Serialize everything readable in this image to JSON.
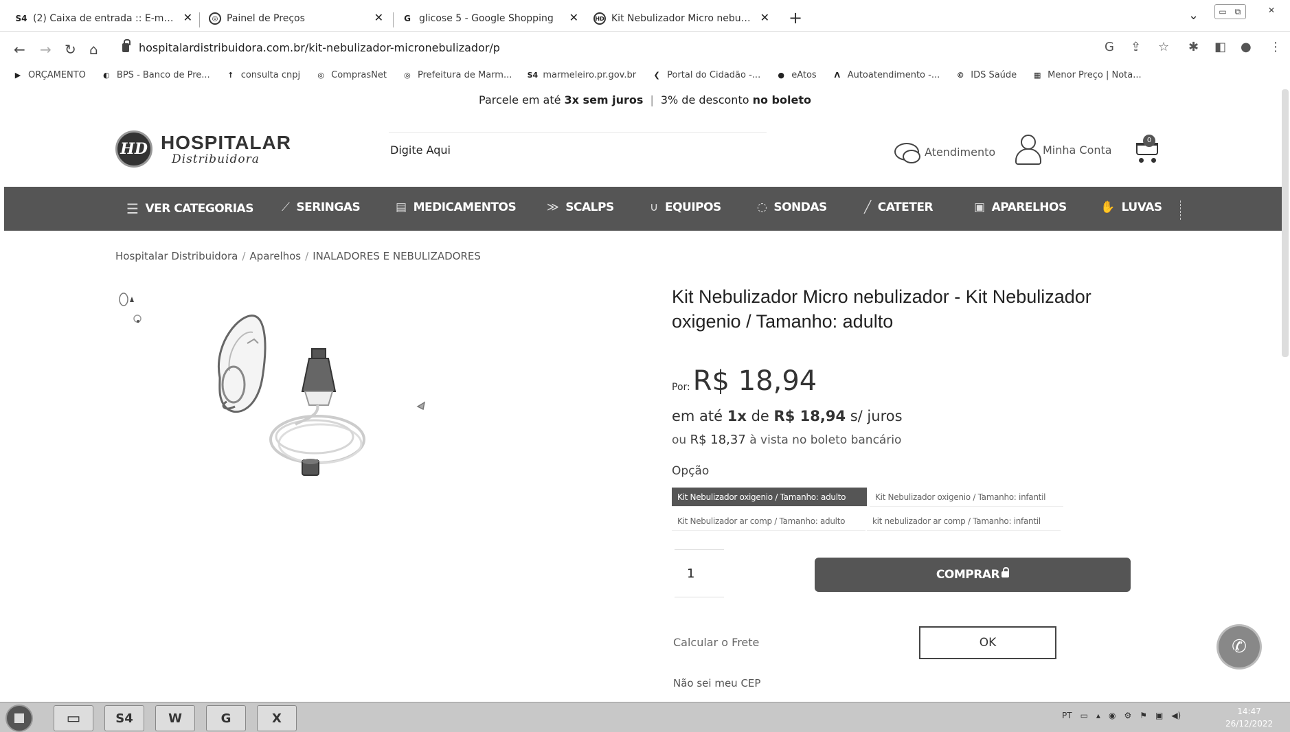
{
  "browser": {
    "tabs": [
      {
        "favicon": "S4",
        "label": "(2) Caixa de entrada :: E-mail - ..."
      },
      {
        "favicon": "globe",
        "label": "Painel de Preços"
      },
      {
        "favicon": "G",
        "label": "glicose 5 - Google Shopping"
      },
      {
        "favicon": "HD",
        "label": "Kit Nebulizador Micro nebulizad..."
      }
    ],
    "url": "hospitalardistribuidora.com.br/kit-nebulizador-micronebulizador/p",
    "bookmarks": [
      "ORÇAMENTO",
      "BPS - Banco de Pre...",
      "consulta cnpj",
      "ComprasNet",
      "Prefeitura de Marm...",
      "marmeleiro.pr.gov.br",
      "Portal do Cidadão -...",
      "eAtos",
      "Autoatendimento -...",
      "IDS Saúde",
      "Menor Preço | Nota..."
    ]
  },
  "promo": {
    "part1": "Parcele em até ",
    "part1_bold": "3x sem juros",
    "sep": "|",
    "part2": "3% de desconto ",
    "part2_bold": "no boleto"
  },
  "header": {
    "logo_mark": "HD",
    "logo_title": "HOSPITALAR",
    "logo_subtitle": "Distribuidora",
    "search_placeholder": "Digite Aqui",
    "atendimento": "Atendimento",
    "minha_conta": "Minha Conta",
    "cart_count": "0"
  },
  "categories": [
    {
      "icon": "☰",
      "label": "VER CATEGORIAS"
    },
    {
      "icon": "⟋",
      "label": "SERINGAS"
    },
    {
      "icon": "▤",
      "label": "MEDICAMENTOS"
    },
    {
      "icon": "≫",
      "label": "SCALPS"
    },
    {
      "icon": "∪",
      "label": "EQUIPOS"
    },
    {
      "icon": "◌",
      "label": "SONDAS"
    },
    {
      "icon": "╱",
      "label": "CATETER"
    },
    {
      "icon": "▣",
      "label": "APARELHOS"
    },
    {
      "icon": "✋",
      "label": "LUVAS"
    }
  ],
  "breadcrumb": [
    "Hospitalar Distribuidora",
    "Aparelhos",
    "INALADORES E NEBULIZADORES"
  ],
  "product": {
    "title": "Kit Nebulizador Micro nebulizador - Kit Nebulizador oxigenio / Tamanho: adulto",
    "price_prefix": "Por:",
    "price": "R$ 18,94",
    "installment_pre": "em até ",
    "installment_count": "1x",
    "installment_mid": " de ",
    "installment_value": "R$ 18,94",
    "installment_post": " s/ juros",
    "cash_pre": "ou ",
    "cash_value": "R$ 18,37",
    "cash_post": " à vista no boleto bancário",
    "option_label": "Opção",
    "options": [
      "Kit Nebulizador oxigenio / Tamanho: adulto",
      "Kit Nebulizador oxigenio / Tamanho: infantil",
      "Kit Nebulizador ar comp / Tamanho: adulto",
      "kit nebulizador ar comp / Tamanho: infantil"
    ],
    "quantity": "1",
    "buy_label": "COMPRAR",
    "shipping_label": "Calcular o Frete",
    "ok_label": "OK",
    "cep_link": "Não sei meu CEP"
  },
  "taskbar": {
    "apps": [
      "S4",
      "W",
      "G",
      "X"
    ],
    "lang": "PT",
    "time": "14:47",
    "date": "26/12/2022"
  }
}
